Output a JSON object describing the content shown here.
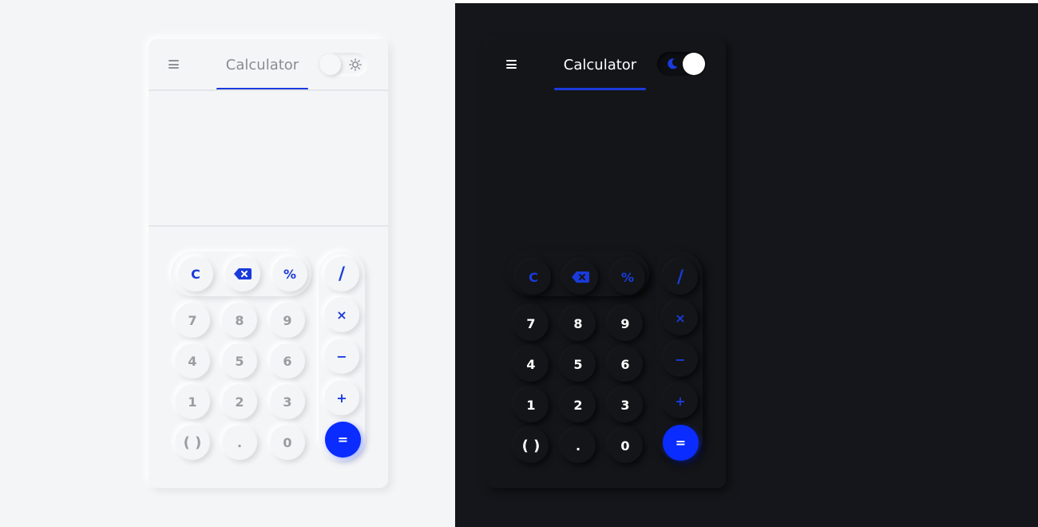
{
  "theme_colors": {
    "accent": "#0a2cff",
    "light_bg": "#f4f5f7",
    "dark_bg": "#15161b"
  },
  "light": {
    "title": "Calculator",
    "menu_icon": "hamburger-menu-icon",
    "toggle_icon": "sun-icon",
    "keys": {
      "clear": "C",
      "backspace_icon": "backspace-icon",
      "percent": "%",
      "divide": "/",
      "multiply": "×",
      "minus": "−",
      "plus": "+",
      "equals": "=",
      "k7": "7",
      "k8": "8",
      "k9": "9",
      "k4": "4",
      "k5": "5",
      "k6": "6",
      "k1": "1",
      "k2": "2",
      "k3": "3",
      "paren": "( )",
      "dot": ".",
      "k0": "0"
    }
  },
  "dark": {
    "title": "Calculator",
    "menu_icon": "hamburger-menu-icon",
    "toggle_icon": "moon-icon",
    "keys": {
      "clear": "C",
      "backspace_icon": "backspace-icon",
      "percent": "%",
      "divide": "/",
      "multiply": "×",
      "minus": "−",
      "plus": "+",
      "equals": "=",
      "k7": "7",
      "k8": "8",
      "k9": "9",
      "k4": "4",
      "k5": "5",
      "k6": "6",
      "k1": "1",
      "k2": "2",
      "k3": "3",
      "paren": "( )",
      "dot": ".",
      "k0": "0"
    }
  }
}
